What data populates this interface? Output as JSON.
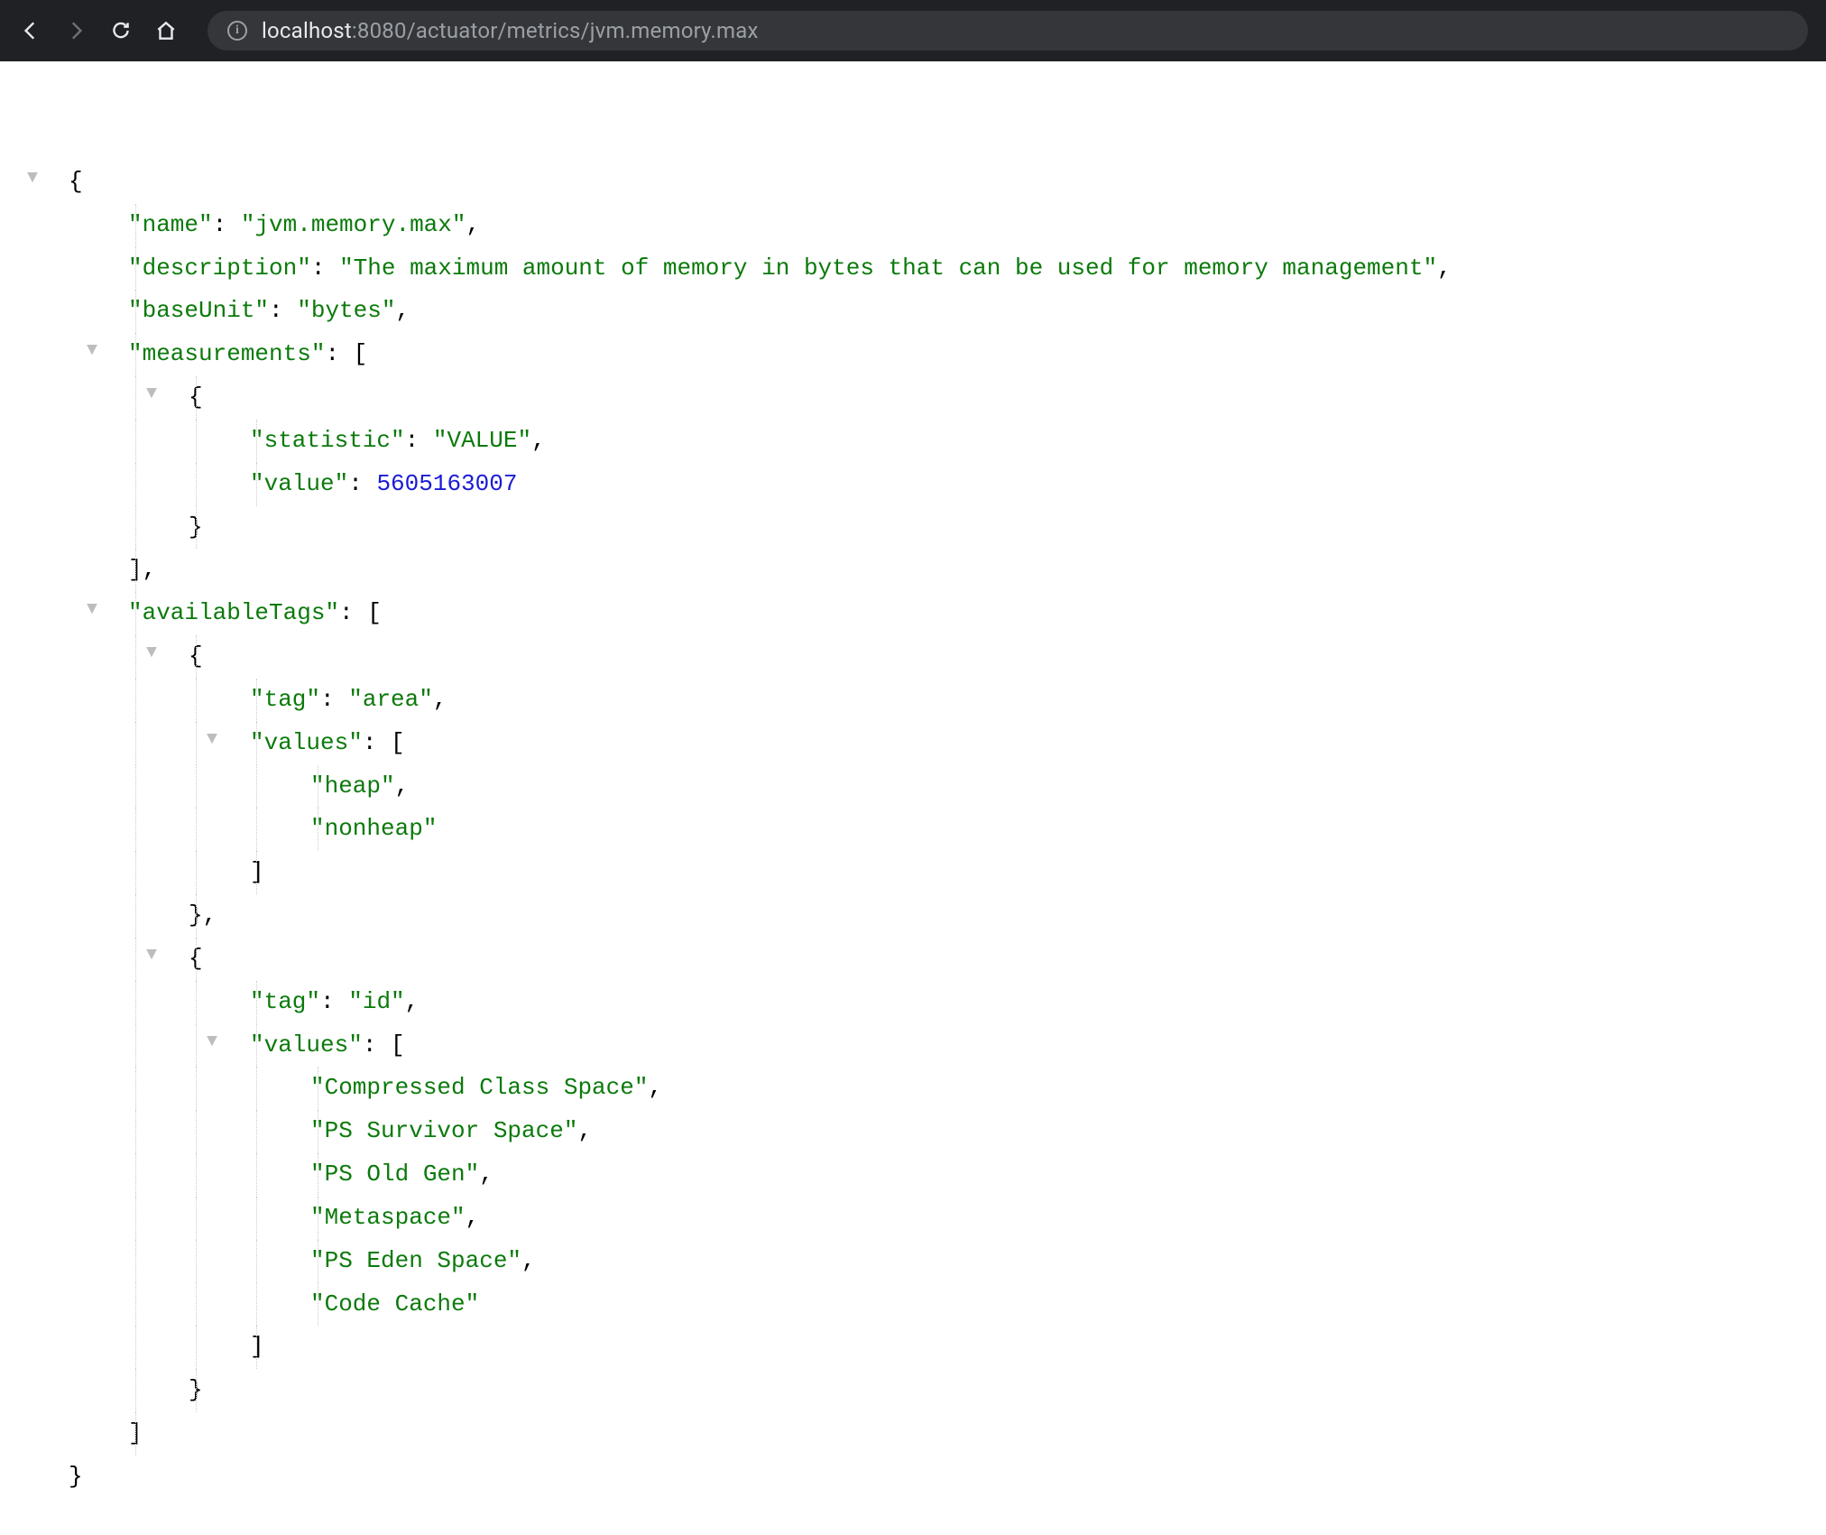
{
  "browser": {
    "url_host": "localhost",
    "url_port": ":8080",
    "url_path": "/actuator/metrics/jvm.memory.max"
  },
  "json": {
    "name_key": "\"name\"",
    "name_val": "\"jvm.memory.max\"",
    "description_key": "\"description\"",
    "description_val": "\"The maximum amount of memory in bytes that can be used for memory management\"",
    "baseUnit_key": "\"baseUnit\"",
    "baseUnit_val": "\"bytes\"",
    "measurements_key": "\"measurements\"",
    "measurements": [
      {
        "statistic_key": "\"statistic\"",
        "statistic_val": "\"VALUE\"",
        "value_key": "\"value\"",
        "value_val": "5605163007"
      }
    ],
    "availableTags_key": "\"availableTags\"",
    "availableTags": [
      {
        "tag_key": "\"tag\"",
        "tag_val": "\"area\"",
        "values_key": "\"values\"",
        "values": [
          "\"heap\"",
          "\"nonheap\""
        ]
      },
      {
        "tag_key": "\"tag\"",
        "tag_val": "\"id\"",
        "values_key": "\"values\"",
        "values": [
          "\"Compressed Class Space\"",
          "\"PS Survivor Space\"",
          "\"PS Old Gen\"",
          "\"Metaspace\"",
          "\"PS Eden Space\"",
          "\"Code Cache\""
        ]
      }
    ]
  }
}
